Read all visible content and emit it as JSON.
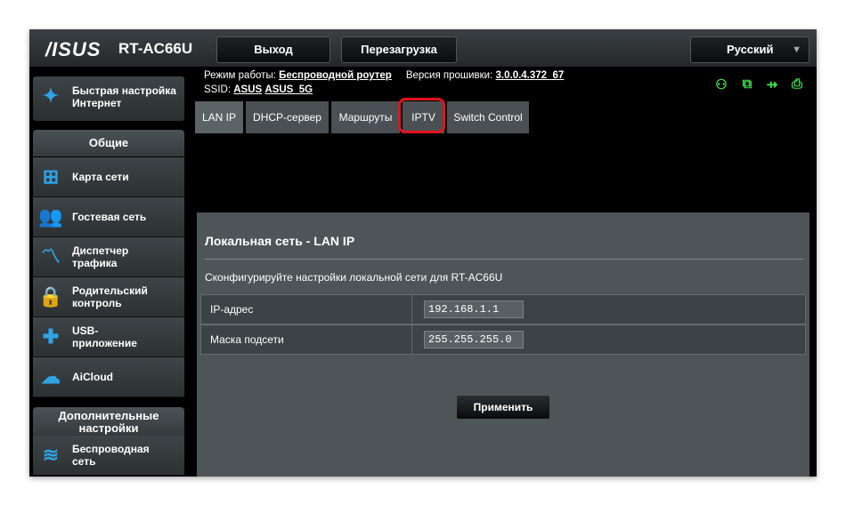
{
  "header": {
    "logo": "/ISUS",
    "model": "RT-AC66U",
    "logout": "Выход",
    "reboot": "Перезагрузка",
    "language": "Русский"
  },
  "info": {
    "mode_label": "Режим работы:",
    "mode_value": "Беспроводной роутер",
    "fw_label": "Версия прошивки:",
    "fw_value": "3.0.0.4.372_67",
    "ssid_label": "SSID:",
    "ssid_1": "ASUS",
    "ssid_2": "ASUS_5G"
  },
  "status_icons": [
    "user-status-icon",
    "copy-status-icon",
    "usb-icon",
    "printer-icon"
  ],
  "sidebar": {
    "quick": "Быстрая настройка Интернет",
    "general": "Общие",
    "items": [
      {
        "label": "Карта сети",
        "icon": "network-map-icon"
      },
      {
        "label": "Гостевая сеть",
        "icon": "guest-network-icon"
      },
      {
        "label": "Диспетчер трафика",
        "icon": "traffic-manager-icon"
      },
      {
        "label": "Родительский контроль",
        "icon": "lock-icon"
      },
      {
        "label": "USB-приложение",
        "icon": "puzzle-icon"
      },
      {
        "label": "AiCloud",
        "icon": "cloud-icon"
      }
    ],
    "advanced": "Дополнительные настройки",
    "adv_items": [
      {
        "label": "Беспроводная сеть",
        "icon": "wifi-icon"
      }
    ]
  },
  "tabs": [
    "LAN IP",
    "DHCP-сервер",
    "Маршруты",
    "IPTV",
    "Switch Control"
  ],
  "panel": {
    "title": "Локальная сеть - LAN IP",
    "description": "Сконфигурируйте настройки локальной сети для RT-AC66U",
    "rows": [
      {
        "label": "IP-адрес",
        "value": "192.168.1.1"
      },
      {
        "label": "Маска подсети",
        "value": "255.255.255.0"
      }
    ],
    "apply": "Применить"
  },
  "colors": {
    "highlight": "#e3141d",
    "status_green": "#3be04a",
    "icon_blue": "#2fa3e6"
  }
}
